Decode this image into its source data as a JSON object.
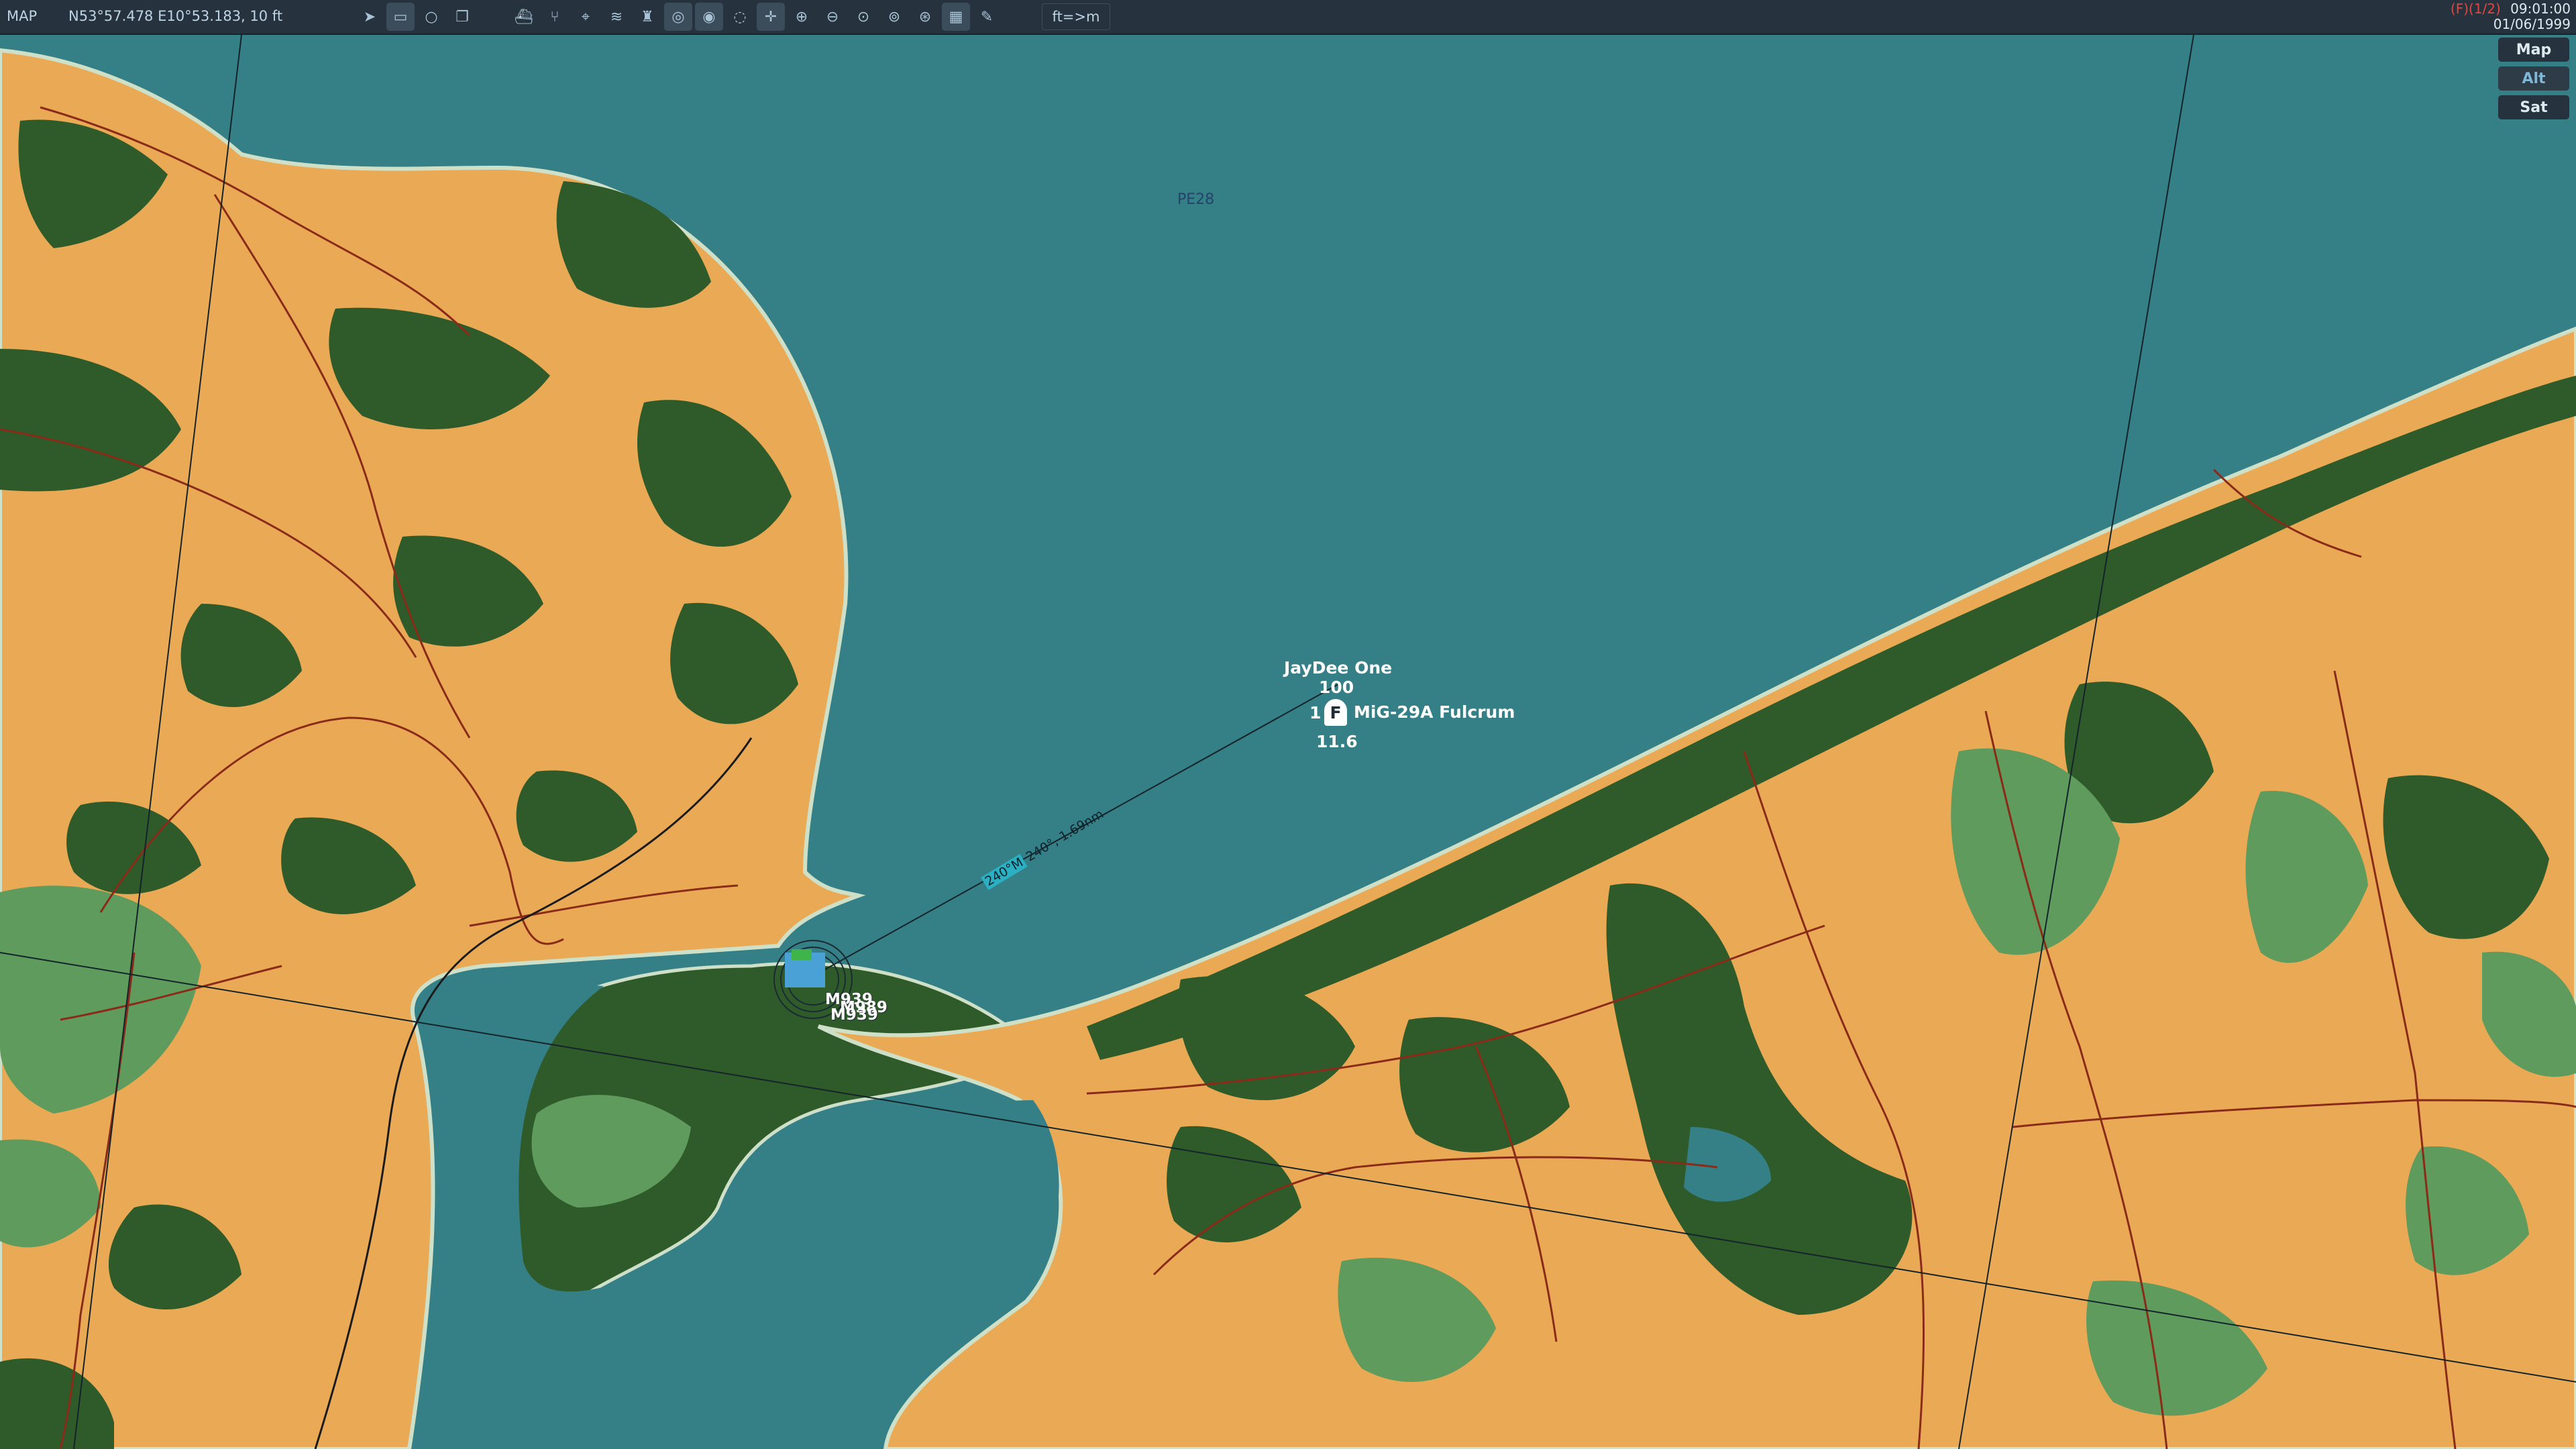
{
  "toolbar": {
    "mode_label": "MAP",
    "coordinates": "N53°57.478 E10°53.183, 10 ft",
    "units_toggle": "ft=>m",
    "coalition": "(F)(1/2)",
    "time": "09:01:00",
    "date": "01/06/1999",
    "tools": [
      {
        "name": "send-icon",
        "glyph": "➤"
      },
      {
        "name": "ruler-icon",
        "glyph": "▭"
      },
      {
        "name": "circle-icon",
        "glyph": "○"
      },
      {
        "name": "layers-icon",
        "glyph": "❐"
      },
      {
        "name": "ship-icon",
        "glyph": "⛴"
      },
      {
        "name": "route-icon",
        "glyph": "⑂"
      },
      {
        "name": "target-icon",
        "glyph": "⌖"
      },
      {
        "name": "wifi-icon",
        "glyph": "≋"
      },
      {
        "name": "tower-icon",
        "glyph": "♜"
      },
      {
        "name": "radar-icon",
        "glyph": "◎"
      },
      {
        "name": "radar-alt-icon",
        "glyph": "◉"
      },
      {
        "name": "radar-dim-icon",
        "glyph": "◌"
      },
      {
        "name": "crosshair-icon",
        "glyph": "✛"
      },
      {
        "name": "zoom-in-icon",
        "glyph": "⊕"
      },
      {
        "name": "zoom-out-icon",
        "glyph": "⊖"
      },
      {
        "name": "zoom-fit-icon",
        "glyph": "⊙"
      },
      {
        "name": "compass-icon",
        "glyph": "⊚"
      },
      {
        "name": "globe-icon",
        "glyph": "⊛"
      },
      {
        "name": "grid-icon",
        "glyph": "▦"
      },
      {
        "name": "pencil-icon",
        "glyph": "✎"
      }
    ]
  },
  "layers": [
    {
      "label": "Map"
    },
    {
      "label": "Alt"
    },
    {
      "label": "Sat"
    }
  ],
  "map": {
    "grid_label": "PE28",
    "unit": {
      "name": "JayDee One",
      "altitude": "100",
      "count": "1",
      "icon_letter": "F",
      "type": "MiG-29A Fulcrum",
      "speed": "11.6"
    },
    "bearing": {
      "magnetic": "240°M",
      "true_and_distance": "240°, 1.69nm"
    },
    "airfield_labels": [
      "M939",
      "M989",
      "M939"
    ],
    "colors": {
      "water": "#357f86",
      "farmland": "#e9a955",
      "forest": "#2f5a2a",
      "meadow": "#5e9b5c",
      "road": "#8a2b1a",
      "rail": "#1b1b1b"
    }
  }
}
